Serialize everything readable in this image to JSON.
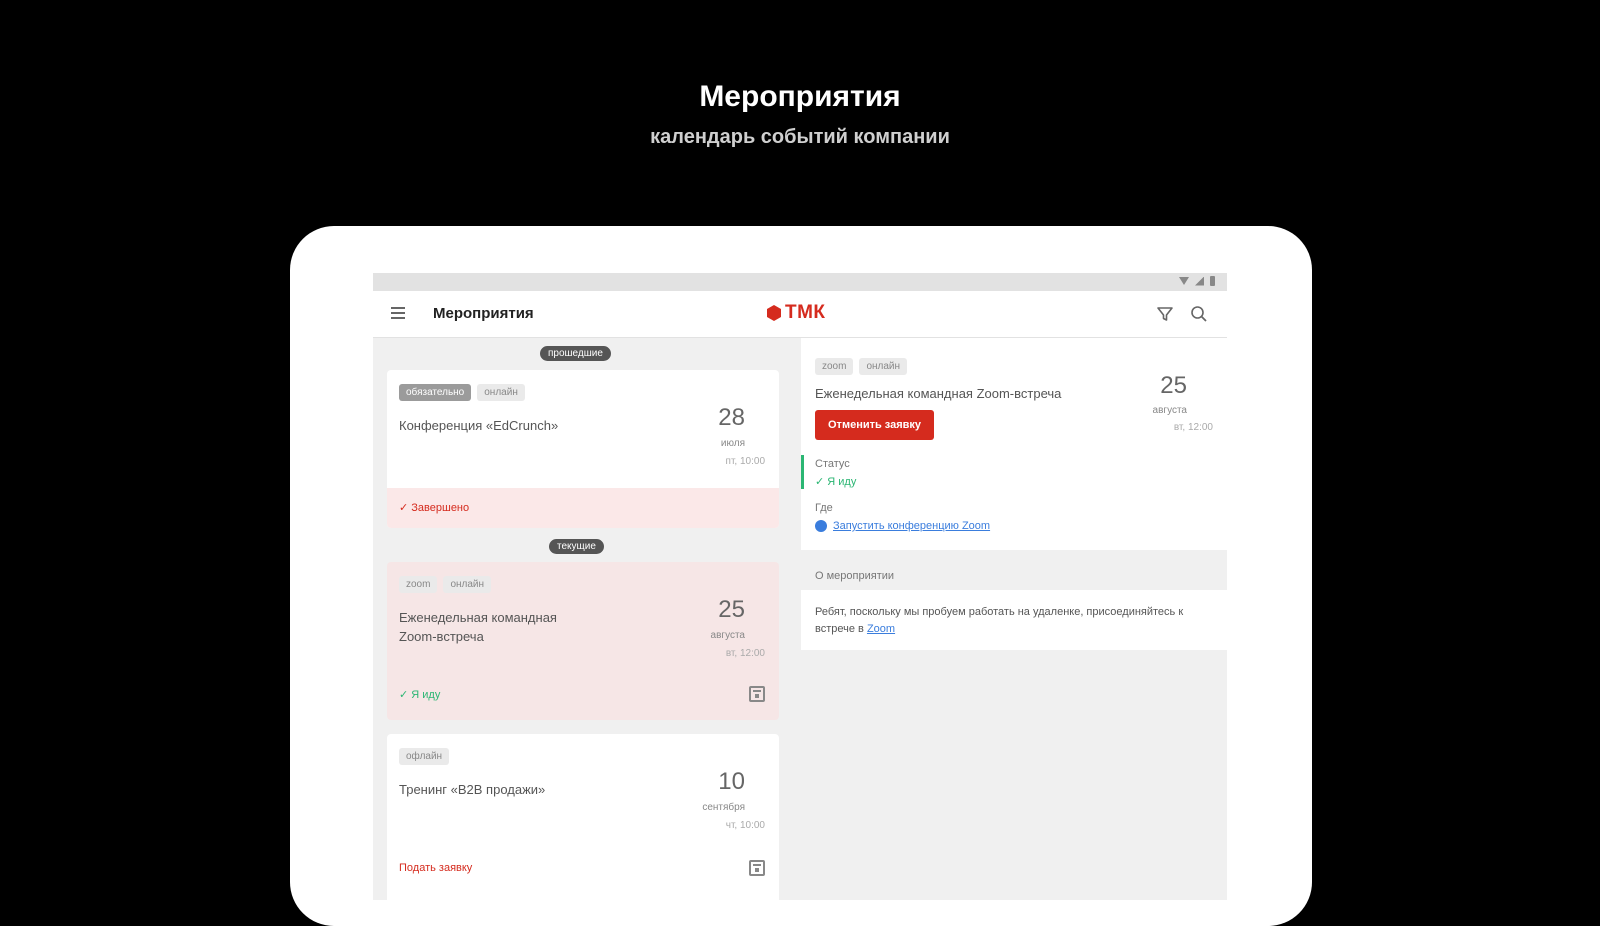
{
  "promo": {
    "title": "Мероприятия",
    "subtitle": "календарь событий компании"
  },
  "appbar": {
    "title": "Мероприятия",
    "logo_text": "ТМК"
  },
  "colors": {
    "brand": "#d52b1e",
    "success": "#2bb673",
    "link": "#3a7ddd"
  },
  "events_list": {
    "section_past": "прошедшие",
    "section_current": "текущие",
    "items": [
      {
        "tags": [
          "обязательно",
          "онлайн"
        ],
        "title": "Конференция «EdCrunch»",
        "day": "28",
        "month": "июля",
        "time": "пт, 10:00",
        "status": "✓ Завершено"
      },
      {
        "tags": [
          "zoom",
          "онлайн"
        ],
        "title": "Еженедельная командная Zoom-встреча",
        "day": "25",
        "month": "августа",
        "time": "вт, 12:00",
        "status": "✓ Я иду"
      },
      {
        "tags": [
          "офлайн"
        ],
        "title": "Тренинг «B2B продажи»",
        "day": "10",
        "month": "сентября",
        "time": "чт, 10:00",
        "action": "Подать заявку"
      }
    ]
  },
  "detail": {
    "tags": [
      "zoom",
      "онлайн"
    ],
    "title": "Еженедельная командная Zoom-встреча",
    "day": "25",
    "month": "августа",
    "time": "вт, 12:00",
    "cancel_label": "Отменить заявку",
    "status_label": "Статус",
    "status_value": "✓ Я иду",
    "where_label": "Где",
    "zoom_link": "Запустить конференцию Zoom",
    "about_label": "О мероприятии",
    "about_text": "Ребят, поскольку мы пробуем работать на удаленке, присоединяйтесь к встрече в",
    "about_link": "Zoom"
  }
}
